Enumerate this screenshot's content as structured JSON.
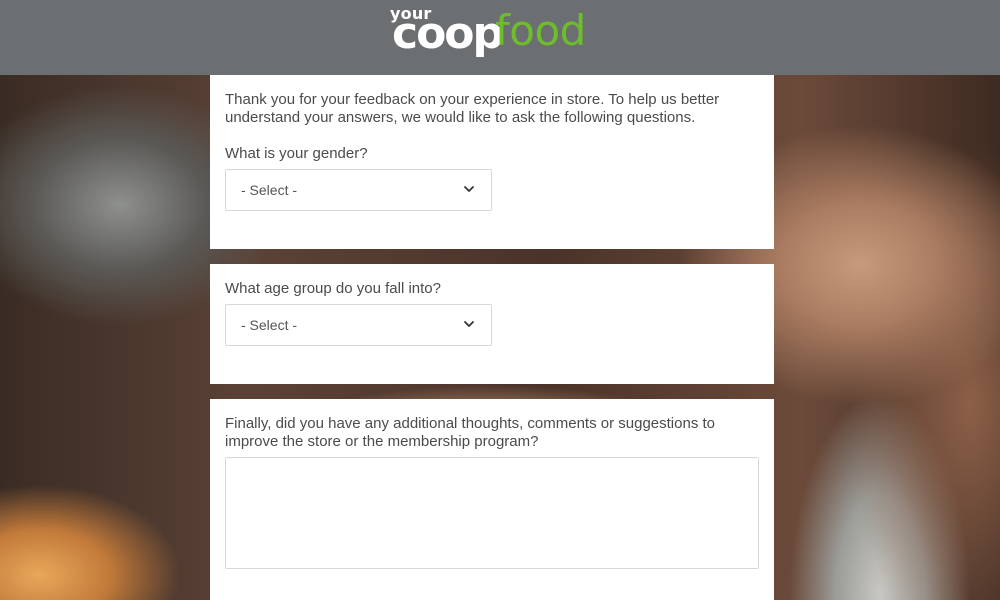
{
  "header": {
    "logo": {
      "your": "your",
      "coop": "coop",
      "food": "food"
    }
  },
  "survey": {
    "intro": "Thank you for your feedback on your experience in store. To help us better understand your answers, we would like to ask the following questions.",
    "gender": {
      "question": "What is your gender?",
      "selected": "- Select -"
    },
    "age": {
      "question": "What age group do you fall into?",
      "selected": "- Select -"
    },
    "comments": {
      "question": "Finally, did you have any additional thoughts, comments or suggestions to improve the store or the membership program?",
      "value": ""
    }
  },
  "icons": {
    "dropdown": "chevron-down-icon"
  },
  "colors": {
    "header_bg": "#6c6f72",
    "brand_green": "#6ebd2b",
    "card_bg": "#ffffff",
    "text": "#4b4b4b"
  }
}
